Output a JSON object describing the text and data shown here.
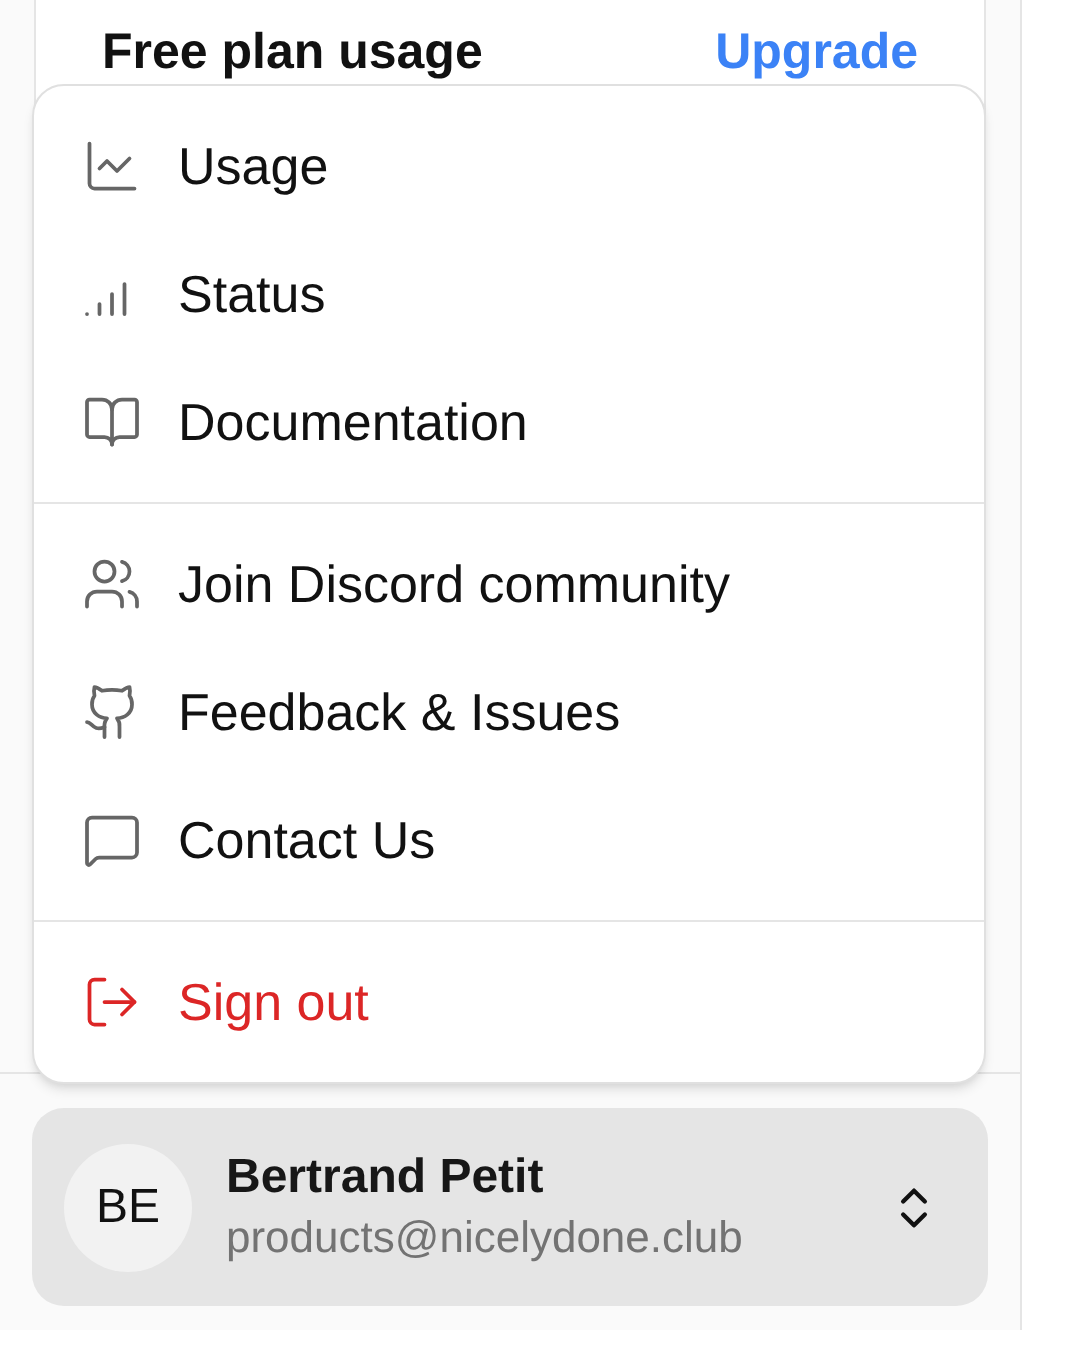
{
  "plan_card": {
    "title": "Free plan usage",
    "action": "Upgrade"
  },
  "menu": {
    "groups": [
      {
        "items": [
          {
            "label": "Usage",
            "kind": "normal"
          },
          {
            "label": "Status",
            "kind": "normal"
          },
          {
            "label": "Documentation",
            "kind": "normal"
          }
        ]
      },
      {
        "items": [
          {
            "label": "Join Discord community",
            "kind": "normal"
          },
          {
            "label": "Feedback & Issues",
            "kind": "normal"
          },
          {
            "label": "Contact Us",
            "kind": "normal"
          }
        ]
      },
      {
        "items": [
          {
            "label": "Sign out",
            "kind": "danger"
          }
        ]
      }
    ]
  },
  "user": {
    "initials": "BE",
    "name": "Bertrand Petit",
    "email": "products@nicelydone.club"
  }
}
